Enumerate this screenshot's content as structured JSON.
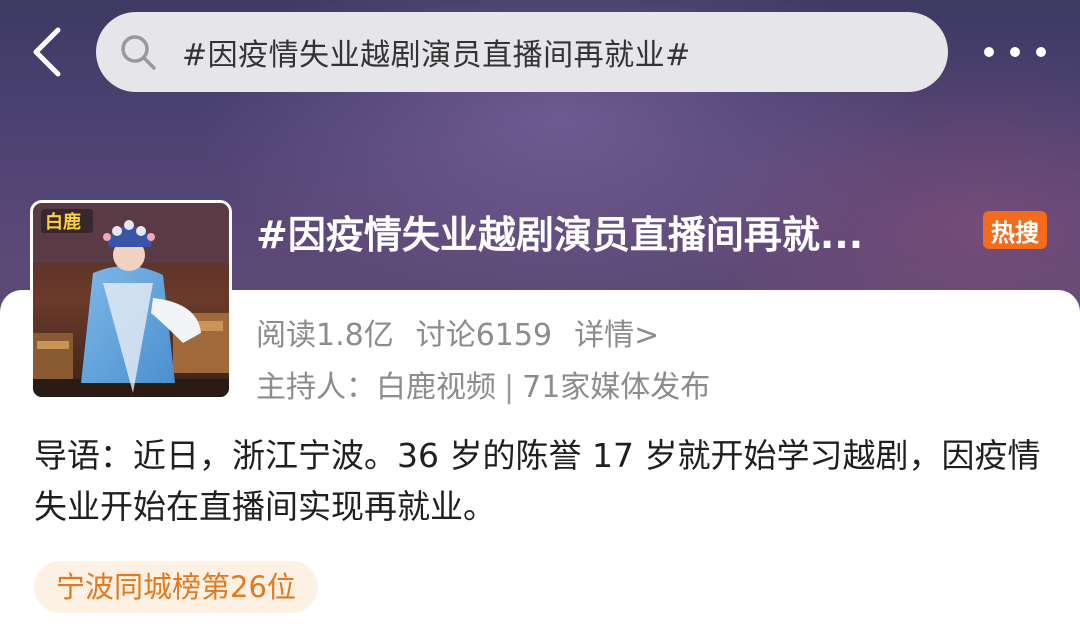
{
  "header": {
    "search_text": "#因疫情失业越剧演员直播间再就业#",
    "back_icon": "chevron-left-icon",
    "search_icon": "search-icon",
    "more_icon": "more-horizontal-icon"
  },
  "topic": {
    "title": "#因疫情失业越剧演员直播间再就...",
    "hot_badge": "热搜",
    "thumbnail_logo": "白鹿",
    "stats": {
      "reads": "阅读1.8亿",
      "discussions": "讨论6159",
      "detail_link": "详情>"
    },
    "host_line": {
      "host": "主持人：白鹿视频",
      "separator": "|",
      "media": "71家媒体发布"
    }
  },
  "intro": {
    "text": "导语：近日，浙江宁波。36 岁的陈誉 17 岁就开始学习越剧，因疫情失业开始在直播间实现再就业。"
  },
  "rank_chip": {
    "label": "宁波同城榜第26位"
  },
  "colors": {
    "header_gradient_top": "#3e3a63",
    "header_gradient_bottom": "#5e4a74",
    "hot_badge": "#f36b1c",
    "rank_text": "#e0791f",
    "rank_bg": "#fdf1e3",
    "meta_text": "#8c8c8c"
  }
}
